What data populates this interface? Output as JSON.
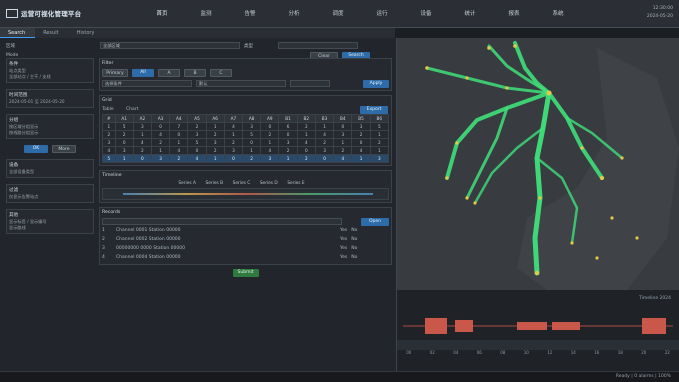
{
  "app": {
    "title": "运营可视化管理平台",
    "nav": [
      "首页",
      "监测",
      "告警",
      "分析",
      "调度",
      "运行",
      "设备",
      "统计",
      "报表",
      "系统"
    ],
    "status_time": [
      "12:30:00",
      "2024-05-20"
    ]
  },
  "tabs": [
    "Search",
    "Result",
    "History"
  ],
  "toolbar": {
    "label1": "区域",
    "select1": "全部区域",
    "label2": "类型",
    "btn_reset": "Clear",
    "btn_query": "Search",
    "row2_label": "Mode"
  },
  "sidebar": {
    "sections": [
      {
        "title": "条件",
        "lines": [
          "站点类型",
          "全部站点 / 主干 / 支线"
        ]
      },
      {
        "title": "时间范围",
        "lines": [
          "2024-05-01 至 2024-05-20"
        ]
      },
      {
        "title": "分组",
        "lines": [
          "按区域分组显示",
          "按线路分组显示"
        ]
      },
      {
        "title": "设备",
        "lines": [
          "全部设备类型"
        ]
      },
      {
        "title": "过滤",
        "lines": [
          "仅显示告警站点"
        ]
      },
      {
        "title": "其他",
        "lines": [
          "显示标签 / 显示编号",
          "显示路线"
        ]
      }
    ],
    "btn_apply": "OK",
    "btn_more": "More"
  },
  "main": {
    "filter": {
      "title": "Filter",
      "chips": [
        "Primary",
        "All",
        "A",
        "B",
        "C"
      ],
      "field_a": "选择条件",
      "field_b": "默认",
      "btn": "Apply"
    },
    "grid": {
      "title": "Grid",
      "tabs": [
        "Table",
        "Chart"
      ],
      "btn": "Export",
      "headers": [
        "#",
        "A1",
        "A2",
        "A3",
        "A4",
        "A5",
        "A6",
        "A7",
        "A8",
        "A9",
        "B1",
        "B2",
        "B3",
        "B4",
        "B5",
        "B6"
      ],
      "rows": [
        [
          "1",
          "5",
          "3",
          "0",
          "7",
          "2",
          "1",
          "4",
          "3",
          "0",
          "6",
          "2",
          "1",
          "0",
          "3",
          "5"
        ],
        [
          "2",
          "2",
          "1",
          "4",
          "0",
          "3",
          "2",
          "1",
          "5",
          "2",
          "0",
          "1",
          "4",
          "3",
          "2",
          "1"
        ],
        [
          "3",
          "0",
          "4",
          "2",
          "1",
          "5",
          "3",
          "2",
          "0",
          "1",
          "3",
          "4",
          "2",
          "1",
          "0",
          "2"
        ],
        [
          "4",
          "3",
          "2",
          "1",
          "4",
          "0",
          "2",
          "3",
          "1",
          "4",
          "2",
          "0",
          "3",
          "2",
          "4",
          "1"
        ],
        [
          "5",
          "1",
          "0",
          "3",
          "2",
          "4",
          "1",
          "0",
          "2",
          "3",
          "1",
          "2",
          "0",
          "4",
          "1",
          "3"
        ]
      ]
    },
    "timeline": {
      "title": "Timeline",
      "legend": [
        "Series A",
        "Series B",
        "Series C",
        "Series D",
        "Series E"
      ]
    },
    "list": {
      "title": "Records",
      "btn": "Open",
      "items": [
        {
          "id": "1",
          "text": "Channel 0001 Station 00000"
        },
        {
          "id": "2",
          "text": "Channel 0002 Station 00000"
        },
        {
          "id": "3",
          "text": "00000000 0000 Station 00000"
        },
        {
          "id": "4",
          "text": "Channel 0004 Station 00000"
        }
      ],
      "col_flags": [
        "Yes",
        "No"
      ]
    },
    "btn_submit": "Submit"
  },
  "map": {
    "colors": {
      "bg": "#3a3d42",
      "land": "#45494e",
      "route": "#3fe07a",
      "node": "#e2c94a"
    }
  },
  "bottom_right": {
    "label": "Timeline 2024",
    "axis": [
      "00",
      "02",
      "04",
      "06",
      "08",
      "10",
      "12",
      "14",
      "16",
      "18",
      "20",
      "22"
    ]
  },
  "footer": {
    "text": "Ready | 0 alarms | 100%"
  }
}
